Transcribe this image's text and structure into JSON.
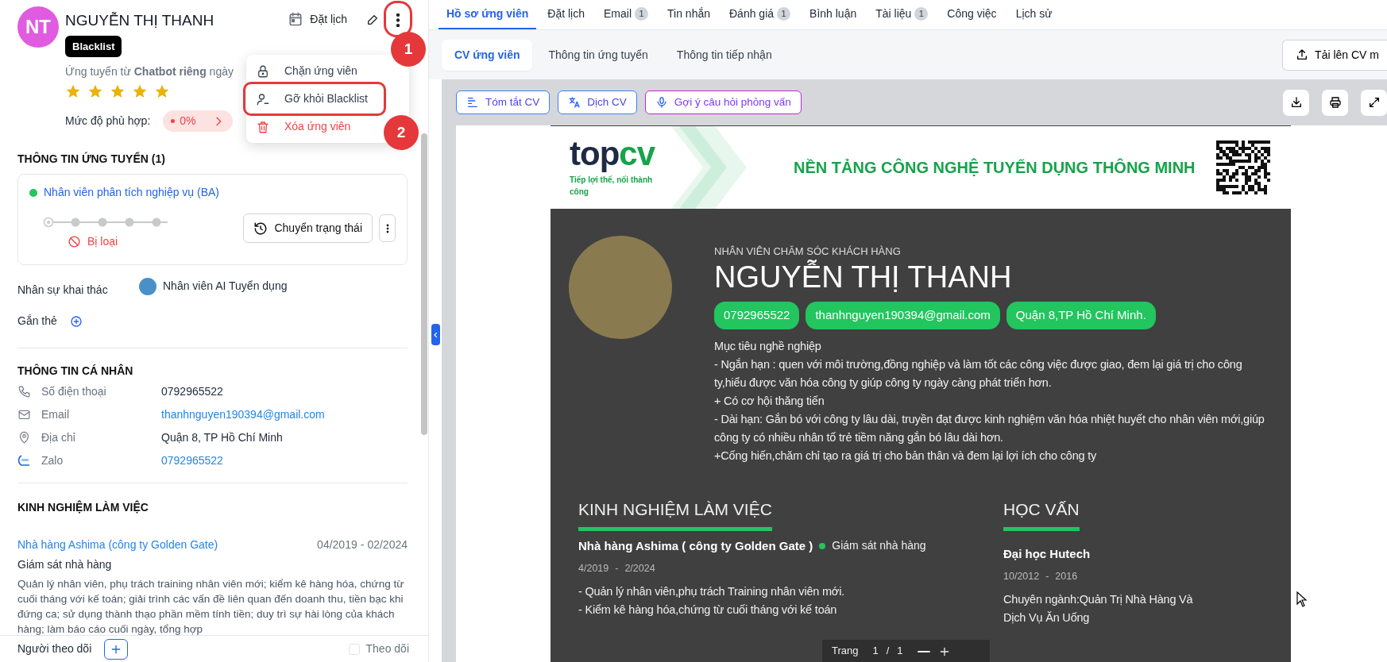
{
  "candidate": {
    "initials": "NT",
    "name": "NGUYỄN THỊ THANH",
    "tag": "Blacklist",
    "source": "Ứng tuyển từ **Chatbot riêng** ngày",
    "stars": 5,
    "match_label": "Mức độ phù hợp:",
    "match_value": "0%"
  },
  "header_actions": {
    "schedule": "Đặt lịch"
  },
  "menu": {
    "items": [
      {
        "kind": "lock",
        "label": "Chặn ứng viên",
        "danger": false
      },
      {
        "kind": "user-minus",
        "label": "Gỡ khỏi Blacklist",
        "danger": false
      },
      {
        "kind": "trash",
        "label": "Xóa ứng viên",
        "danger": true
      }
    ]
  },
  "annotations": [
    {
      "kind": "more-button",
      "label": "1"
    },
    {
      "kind": "menu-item",
      "label": "2"
    }
  ],
  "application": {
    "title": "THÔNG TIN ỨNG TUYỂN (1)",
    "job": "Nhân viên phân tích nghiệp vụ (BA)",
    "steps": [
      {
        "current": true
      },
      {
        "current": false
      },
      {
        "current": false
      },
      {
        "current": false
      },
      {
        "current": false
      }
    ],
    "status": "Bị loại",
    "button": "Chuyển trạng thái"
  },
  "recruiter": {
    "label": "Nhân sự khai thác",
    "name": "Nhân viên AI Tuyển dụng"
  },
  "tags": {
    "label": "Gắn thẻ"
  },
  "personal": {
    "title": "THÔNG TIN CÁ NHÂN",
    "rows": [
      {
        "kind": "phone",
        "label": "Số điện thoại",
        "value": "0792965522",
        "link": false
      },
      {
        "kind": "email",
        "label": "Email",
        "value": "thanhnguyen190394@gmail.com",
        "link": true
      },
      {
        "kind": "address",
        "label": "Địa chỉ",
        "value": "Quận 8, TP Hồ Chí Minh",
        "link": false
      },
      {
        "kind": "zalo",
        "label": "Zalo",
        "value": "0792965522",
        "link": true
      }
    ]
  },
  "experience": {
    "title": "KINH NGHIỆM LÀM VIỆC",
    "items": [
      {
        "company": "Nhà hàng Ashima (công ty Golden Gate)",
        "start": "04/2019",
        "separator": "-",
        "end": "02/2024",
        "role": "Giám sát nhà hàng",
        "description": "Quản lý nhân viên, phụ trách training nhân viên mới; kiểm kê hàng hóa, chứng từ cuối tháng với kế toán; giải trình các vấn đề liên quan đến doanh thu, tiền bạc khi đứng ca; sử dụng thành thạo phần mềm tính tiền; duy trì sự hài lòng của khách hàng; làm báo cáo cuối ngày, tổng hợp"
      }
    ]
  },
  "followers": {
    "label": "Người theo dõi",
    "follow": "Theo dõi",
    "following": false
  },
  "tabs": [
    {
      "label": "Hồ sơ ứng viên",
      "selected": true
    },
    {
      "label": "Đặt lịch",
      "selected": false
    },
    {
      "label": "Email",
      "count": "1",
      "selected": false
    },
    {
      "label": "Tin nhắn",
      "selected": false
    },
    {
      "label": "Đánh giá",
      "count": "1",
      "selected": false
    },
    {
      "label": "Bình luận",
      "selected": false
    },
    {
      "label": "Tài liệu",
      "count": "1",
      "selected": false
    },
    {
      "label": "Công việc",
      "selected": false
    },
    {
      "label": "Lịch sử",
      "selected": false
    }
  ],
  "subtabs": [
    {
      "label": "CV ứng viên",
      "selected": true
    },
    {
      "label": "Thông tin ứng tuyển",
      "selected": false
    },
    {
      "label": "Thông tin tiếp nhận",
      "selected": false
    }
  ],
  "upload": "Tải lên CV m",
  "cv_tools": [
    {
      "kind": "summary",
      "label": "Tóm tắt CV"
    },
    {
      "kind": "translate",
      "label": "Dịch CV"
    },
    {
      "kind": "interview",
      "label": "Gợi ý câu hỏi phỏng vấn"
    }
  ],
  "cv": {
    "logo_parts": [
      "top",
      "cv"
    ],
    "tagline": "Tiếp lợi thế, nối thành công",
    "headline": "NỀN TẢNG CÔNG NGHỆ TUYỂN DỤNG THÔNG MINH",
    "position": "NHÂN VIÊN CHĂM SÓC KHÁCH HÀNG",
    "name": "NGUYỄN THỊ THANH",
    "contacts": [
      "0792965522",
      "thanhnguyen190394@gmail.com",
      "Quận 8,TP Hồ Chí Minh."
    ],
    "objective": [
      "Mục tiêu nghề nghiệp",
      "- Ngắn hạn : quen với môi trường,đồng nghiệp và làm tốt các công việc được giao, đem lại giá trị cho công ty,hiểu được văn hóa công ty giúp công ty ngày càng phát triển hơn.",
      "+ Có cơ hội thăng tiến",
      "- Dài hạn: Gắn bó với công ty lâu dài, truyền đạt được kinh nghiệm văn hóa nhiệt huyết cho nhân viên mới,giúp công ty có nhiều nhân tố trẻ tiềm năng gắn bó lâu dài hơn.",
      "+Cống hiến,chăm chỉ tạo ra giá trị cho bản thân và đem lại lợi ích cho công ty"
    ],
    "experience": {
      "title": "KINH NGHIỆM LÀM VIỆC",
      "company": "Nhà hàng Ashima ( công ty Golden Gate )",
      "role": "Giám sát nhà hàng",
      "start": "4/2019",
      "separator": "-",
      "end": "2/2024",
      "lines": [
        "- Quản lý nhân viên,phụ trách Training nhân viên mới.",
        "- Kiểm kê hàng hóa,chứng từ cuối tháng với kế toán"
      ]
    },
    "education": {
      "title": "HỌC VẤN",
      "school": "Đại học Hutech",
      "start": "10/2012",
      "separator": "-",
      "end": "2016",
      "major": "Chuyên ngành:Quản Trị Nhà Hàng Và Dịch Vụ Ăn Uống"
    }
  },
  "pager": {
    "label": "Trang",
    "page": "1",
    "separator": "/",
    "total": "1"
  }
}
